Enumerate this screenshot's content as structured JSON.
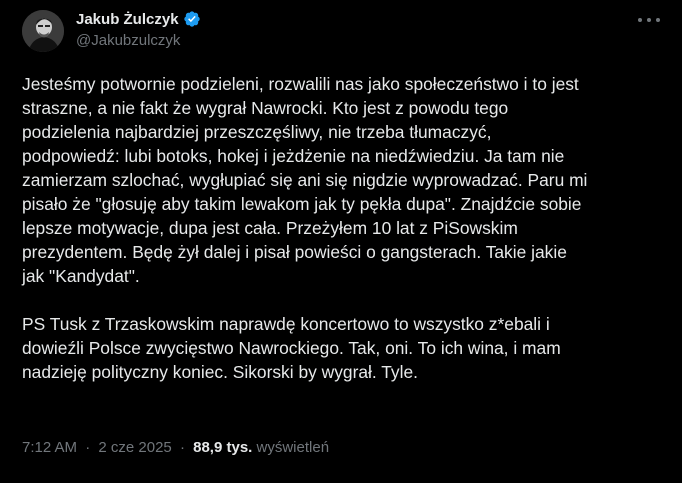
{
  "author": {
    "display_name": "Jakub Żulczyk",
    "handle": "@Jakubzulczyk",
    "verified_color": "#1d9bf0",
    "avatar_icon": "profile-photo"
  },
  "more_icon": "ellipsis-icon",
  "tweet": {
    "lines": [
      "Jesteśmy potwornie podzieleni, rozwalili nas jako społeczeństwo i to jest",
      "straszne, a nie fakt że wygrał Nawrocki. Kto jest z powodu tego",
      "podzielenia najbardziej przeszczęśliwy, nie trzeba tłumaczyć,",
      "podpowiedź: lubi botoks, hokej i jeżdżenie na niedźwiedziu. Ja tam nie",
      "zamierzam szlochać, wygłupiać się ani się nigdzie wyprowadzać. Paru mi",
      "pisało że \"głosuję aby takim lewakom jak ty pękła dupa\". Znajdźcie sobie",
      "lepsze motywacje, dupa jest cała. Przeżyłem 10 lat z PiSowskim",
      "prezydentem. Będę żył dalej i pisał powieści o gangsterach. Takie jakie",
      "jak \"Kandydat\".",
      "",
      "PS Tusk z Trzaskowskim naprawdę koncertowo to wszystko z*ebali i",
      "dowieźli Polsce zwycięstwo Nawrockiego. Tak, oni. To ich wina, i mam",
      "nadzieję polityczny koniec. Sikorski by wygrał. Tyle."
    ]
  },
  "meta": {
    "time": "7:12 AM",
    "separator": "·",
    "date": "2 cze 2025",
    "views_count": "88,9 tys.",
    "views_label": "wyświetleń"
  }
}
